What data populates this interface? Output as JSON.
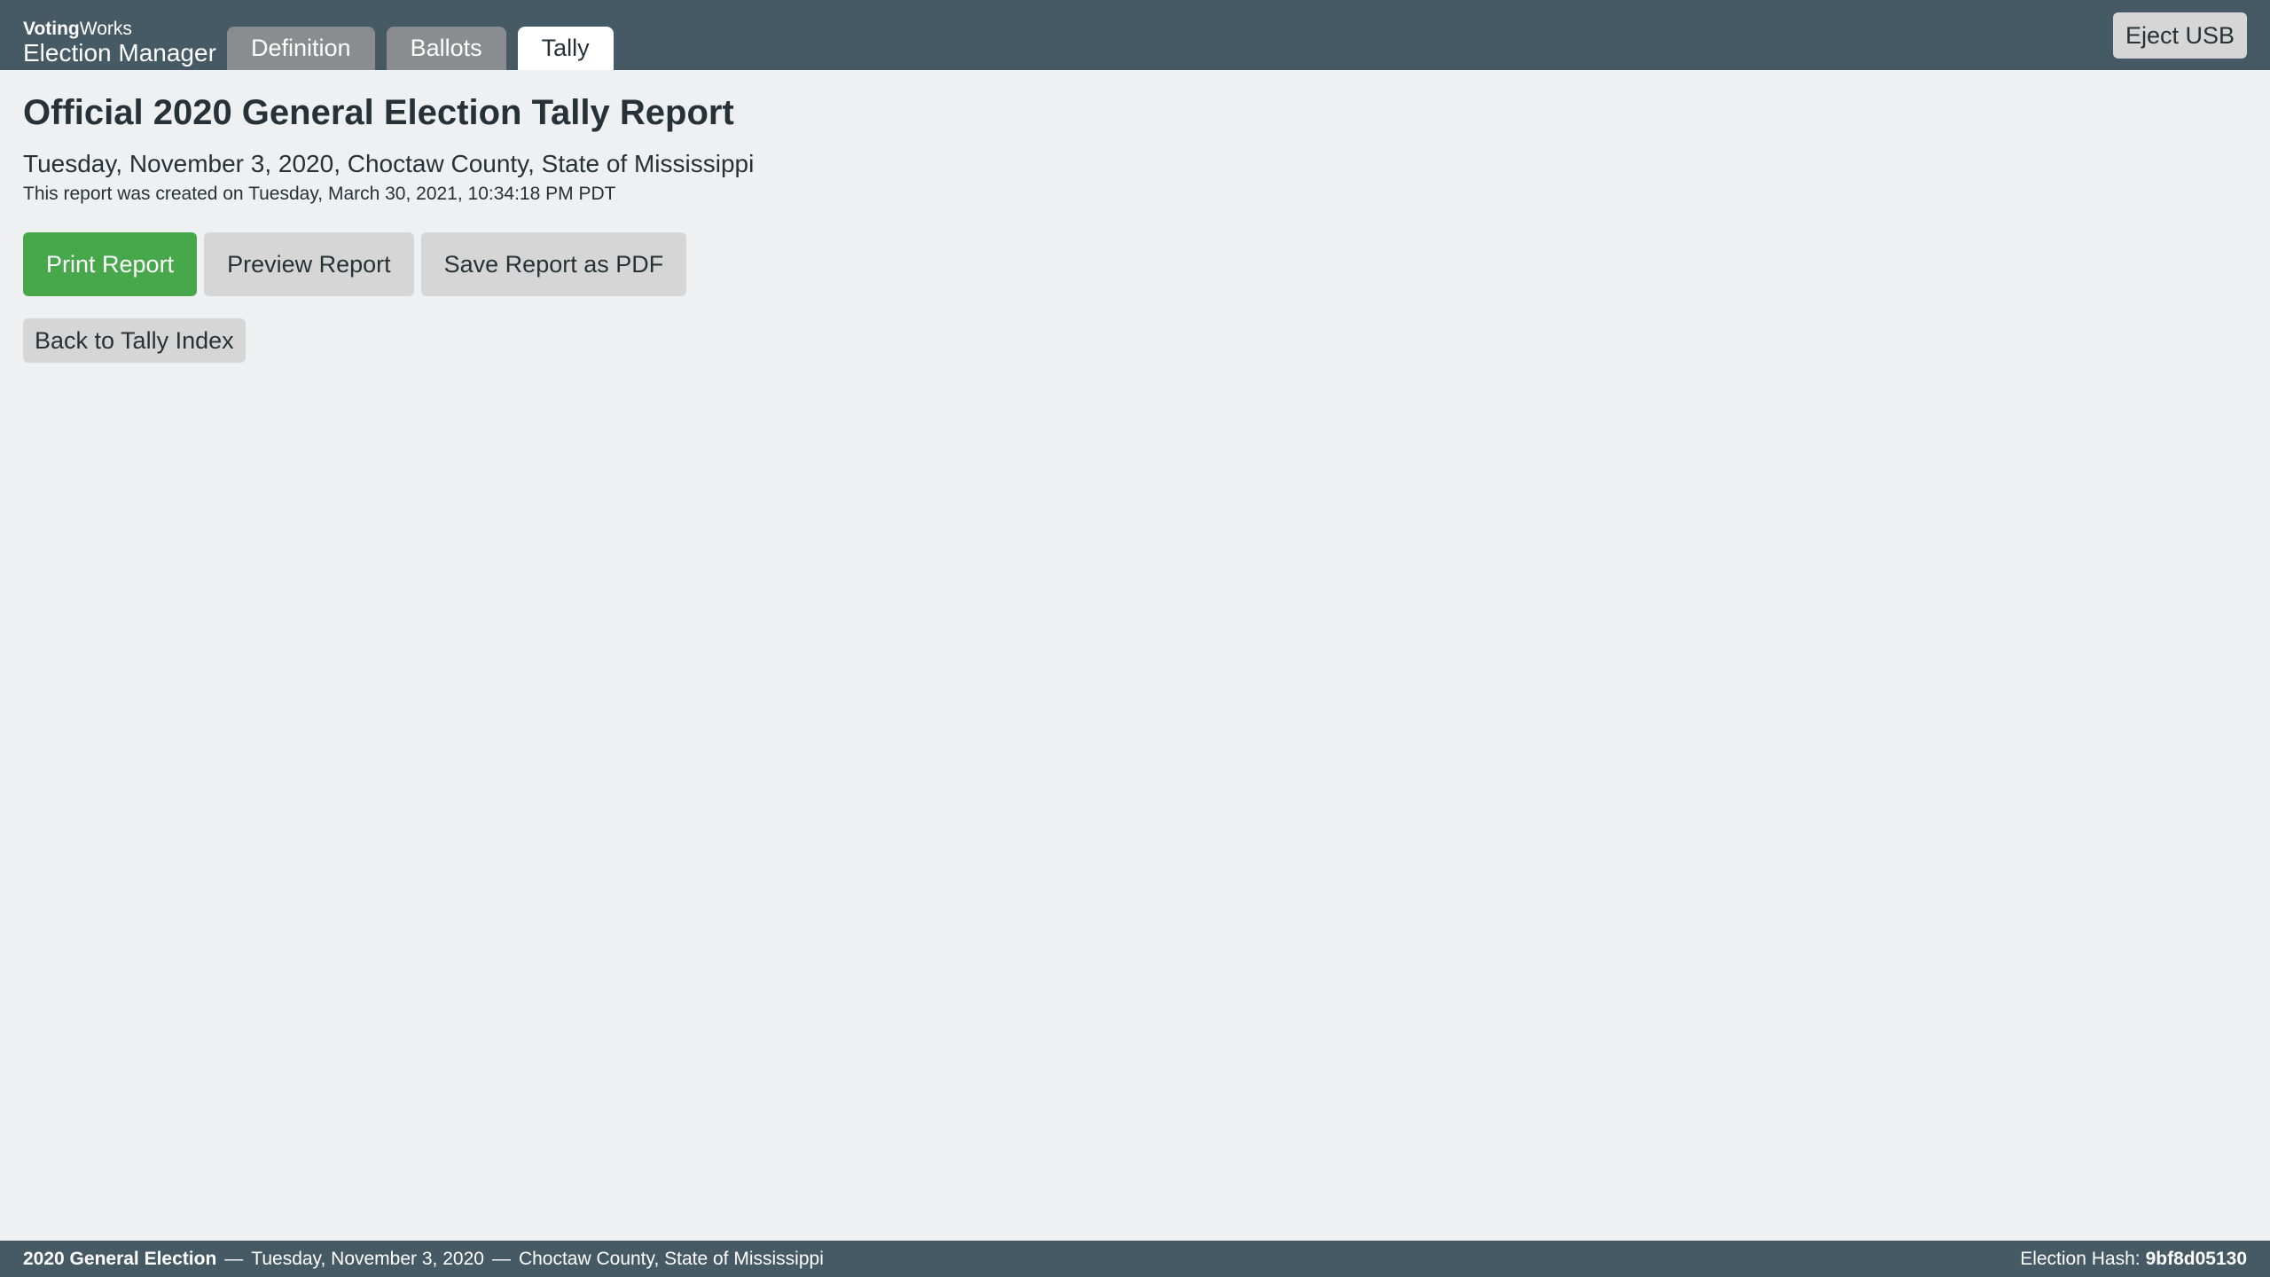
{
  "header": {
    "brand_voting": "Voting",
    "brand_works": "Works",
    "brand_product": "Election Manager",
    "tabs": [
      {
        "label": "Definition",
        "active": false
      },
      {
        "label": "Ballots",
        "active": false
      },
      {
        "label": "Tally",
        "active": true
      }
    ],
    "eject_usb_label": "Eject USB"
  },
  "main": {
    "title": "Official 2020 General Election Tally Report",
    "subtitle": "Tuesday, November 3, 2020, Choctaw County, State of Mississippi",
    "created_note": "This report was created on Tuesday, March 30, 2021, 10:34:18 PM PDT",
    "actions": {
      "print_label": "Print Report",
      "preview_label": "Preview Report",
      "save_pdf_label": "Save Report as PDF"
    },
    "back_label": "Back to Tally Index"
  },
  "footer": {
    "election_name": "2020 General Election",
    "separator": "—",
    "election_date": "Tuesday, November 3, 2020",
    "location": "Choctaw County, State of Mississippi",
    "hash_label": "Election Hash:",
    "hash_value": "9bf8d05130"
  },
  "colors": {
    "header_bg": "#455a64",
    "page_bg": "#eff0f1",
    "primary_button": "#47a74b",
    "secondary_button": "#d6d6d6",
    "inactive_tab": "#8a8d8f"
  }
}
